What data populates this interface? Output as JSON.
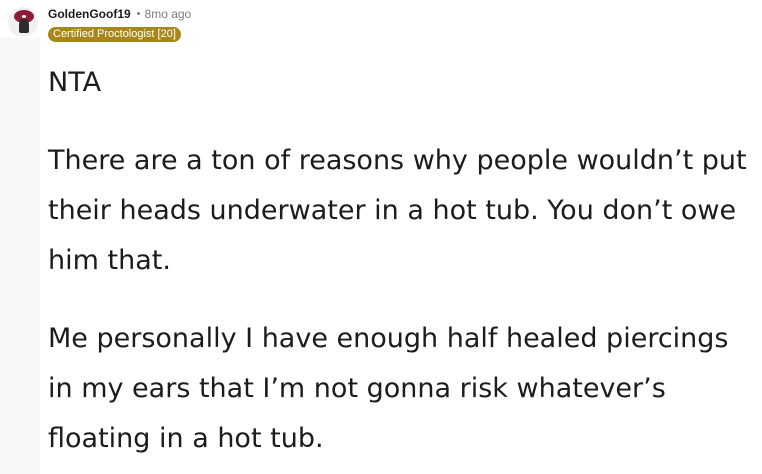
{
  "comment": {
    "username": "GoldenGoof19",
    "separator": "•",
    "time_ago": "8mo ago",
    "flair": "Certified Proctologist [20]",
    "avatar_icon": "snoo-avatar-icon",
    "paragraphs": [
      "NTA",
      "There are a ton of reasons why people wouldn’t put their heads underwater in a hot tub. You don’t owe him that.",
      "Me personally I have enough half healed piercings in my ears that I’m not gonna risk whatever’s floating in a hot tub."
    ]
  },
  "colors": {
    "flair_background": "#a8861a",
    "text": "#1c1c1c",
    "muted": "#7c7c7c",
    "rail": "#f6f7f8"
  }
}
